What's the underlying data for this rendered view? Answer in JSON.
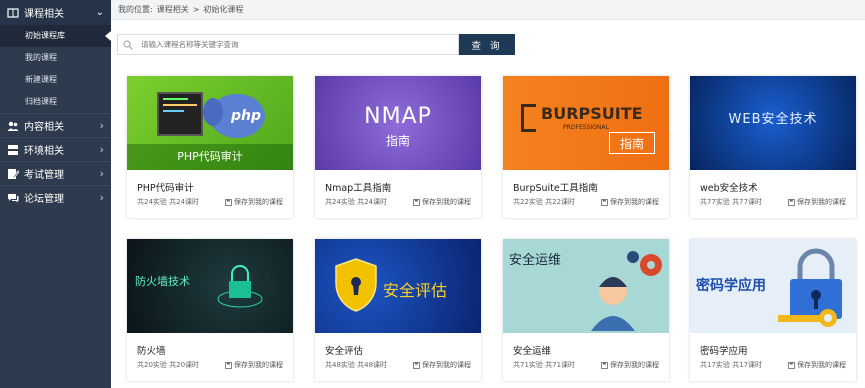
{
  "sidebar": {
    "section_title": "课程相关",
    "sub_items": [
      "初始课程库",
      "我的课程",
      "新建课程",
      "归档课程"
    ],
    "groups": [
      {
        "label": "内容相关",
        "icon": "users-icon"
      },
      {
        "label": "环境相关",
        "icon": "server-icon"
      },
      {
        "label": "考试管理",
        "icon": "edit-icon"
      },
      {
        "label": "论坛管理",
        "icon": "chat-icon"
      }
    ]
  },
  "breadcrumb": {
    "prefix": "我的位置:",
    "level1": "课程相关",
    "sep": ">",
    "level2": "初始化课程"
  },
  "search": {
    "placeholder": "请输入课程名称等关键字查询",
    "button": "查 询"
  },
  "courses": [
    {
      "title": "PHP代码审计",
      "meta": "共24实验 共24课时",
      "save": "保存到我的课程",
      "banner": "PHP代码审计"
    },
    {
      "title": "Nmap工具指南",
      "meta": "共24实验 共24课时",
      "save": "保存到我的课程",
      "banner": "NMAP",
      "banner2": "指南"
    },
    {
      "title": "BurpSuite工具指南",
      "meta": "共22实验 共22课时",
      "save": "保存到我的课程",
      "banner": "BURPSUITE",
      "banner_small": "PROFESSIONAL",
      "banner2": "指南"
    },
    {
      "title": "web安全技术",
      "meta": "共77实验 共77课时",
      "save": "保存到我的课程",
      "banner": "WEB安全技术"
    },
    {
      "title": "防火墙",
      "meta": "共20实验 共20课时",
      "save": "保存到我的课程",
      "banner": "防火墙技术"
    },
    {
      "title": "安全评估",
      "meta": "共48实验 共48课时",
      "save": "保存到我的课程",
      "banner": "安全评估"
    },
    {
      "title": "安全运维",
      "meta": "共71实验 共71课时",
      "save": "保存到我的课程",
      "banner": "安全运维"
    },
    {
      "title": "密码学应用",
      "meta": "共17实验 共17课时",
      "save": "保存到我的课程",
      "banner": "密码学应用"
    }
  ],
  "colors": {
    "sidebar": "#2e3b4e",
    "button": "#1f3a57"
  }
}
